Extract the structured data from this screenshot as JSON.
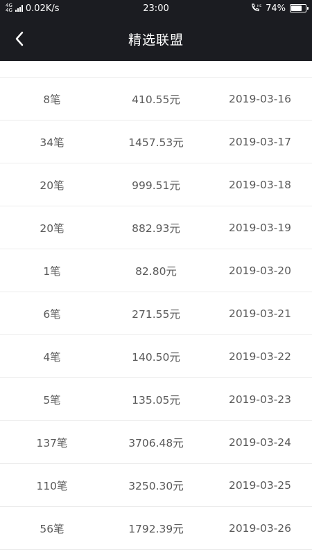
{
  "status_bar": {
    "network_type_top": "4G",
    "network_type_bottom": "4G",
    "speed": "0.02K/s",
    "time": "23:00",
    "call_icon": "phone-hd-icon",
    "battery_percent_label": "74%",
    "battery_level": 0.74
  },
  "header": {
    "back_icon": "chevron-left-icon",
    "title": "精选联盟"
  },
  "rows": [
    {
      "count": "8笔",
      "amount": "410.55元",
      "date": "2019-03-16"
    },
    {
      "count": "34笔",
      "amount": "1457.53元",
      "date": "2019-03-17"
    },
    {
      "count": "20笔",
      "amount": "999.51元",
      "date": "2019-03-18"
    },
    {
      "count": "20笔",
      "amount": "882.93元",
      "date": "2019-03-19"
    },
    {
      "count": "1笔",
      "amount": "82.80元",
      "date": "2019-03-20"
    },
    {
      "count": "6笔",
      "amount": "271.55元",
      "date": "2019-03-21"
    },
    {
      "count": "4笔",
      "amount": "140.50元",
      "date": "2019-03-22"
    },
    {
      "count": "5笔",
      "amount": "135.05元",
      "date": "2019-03-23"
    },
    {
      "count": "137笔",
      "amount": "3706.48元",
      "date": "2019-03-24"
    },
    {
      "count": "110笔",
      "amount": "3250.30元",
      "date": "2019-03-25"
    },
    {
      "count": "56笔",
      "amount": "1792.39元",
      "date": "2019-03-26"
    }
  ]
}
